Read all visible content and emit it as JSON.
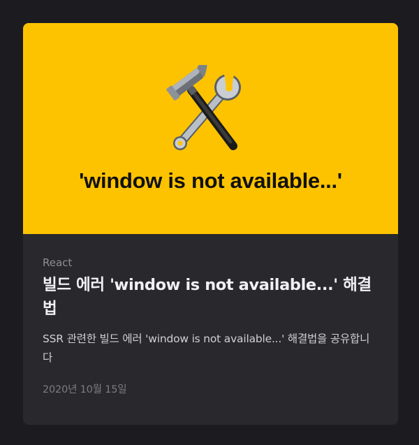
{
  "card": {
    "thumbnail": {
      "icon": "hammer-and-wrench-icon",
      "title": "'window is not available...'",
      "background": "#fec300"
    },
    "category": "React",
    "title": "빌드 에러 'window is not available...' 해결법",
    "excerpt": "SSR 관련한 빌드 에러 'window is not available...' 해결법을 공유합니다",
    "date": "2020년 10월 15일"
  }
}
